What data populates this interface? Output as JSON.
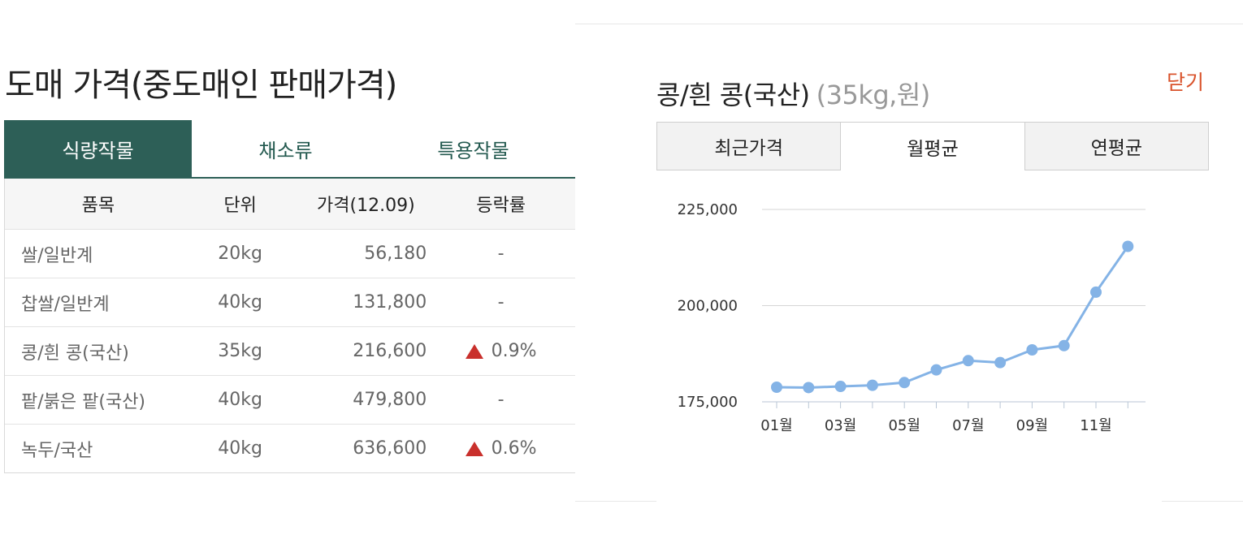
{
  "left": {
    "title": "도매 가격(중도매인 판매가격)",
    "tabs": [
      {
        "label": "식량작물",
        "active": true
      },
      {
        "label": "채소류",
        "active": false
      },
      {
        "label": "특용작물",
        "active": false
      }
    ],
    "table": {
      "headers": [
        "품목",
        "단위",
        "가격(12.09)",
        "등락률"
      ],
      "rows": [
        {
          "item": "쌀/일반계",
          "unit": "20kg",
          "price": "56,180",
          "change": "-",
          "trend": "none"
        },
        {
          "item": "찹쌀/일반계",
          "unit": "40kg",
          "price": "131,800",
          "change": "-",
          "trend": "none"
        },
        {
          "item": "콩/흰 콩(국산)",
          "unit": "35kg",
          "price": "216,600",
          "change": "0.9%",
          "trend": "up"
        },
        {
          "item": "팥/붉은 팥(국산)",
          "unit": "40kg",
          "price": "479,800",
          "change": "-",
          "trend": "none"
        },
        {
          "item": "녹두/국산",
          "unit": "40kg",
          "price": "636,600",
          "change": "0.6%",
          "trend": "up"
        }
      ]
    },
    "colors": {
      "accent": "#2d5f57",
      "up": "#c9302c"
    }
  },
  "detail": {
    "title": "콩/흰 콩(국산)",
    "unit": "(35kg,원)",
    "close_label": "닫기",
    "tabs": [
      {
        "label": "최근가격",
        "active": false
      },
      {
        "label": "월평균",
        "active": true
      },
      {
        "label": "연평균",
        "active": false
      }
    ]
  },
  "chart_data": {
    "type": "line",
    "x": [
      "01월",
      "02월",
      "03월",
      "04월",
      "05월",
      "06월",
      "07월",
      "08월",
      "09월",
      "10월",
      "11월",
      "12월"
    ],
    "x_tick_labels": [
      "01월",
      "03월",
      "05월",
      "07월",
      "09월",
      "11월"
    ],
    "series": [
      {
        "values": [
          178800,
          178700,
          179000,
          179300,
          180000,
          183300,
          185700,
          185200,
          188500,
          189600,
          203500,
          215400
        ],
        "color": "#84b3e6"
      }
    ],
    "y_ticks": [
      175000,
      200000,
      225000
    ],
    "y_tick_labels": [
      "175,000",
      "200,000",
      "225,000"
    ],
    "ylim": [
      175000,
      225000
    ],
    "grid": true
  }
}
